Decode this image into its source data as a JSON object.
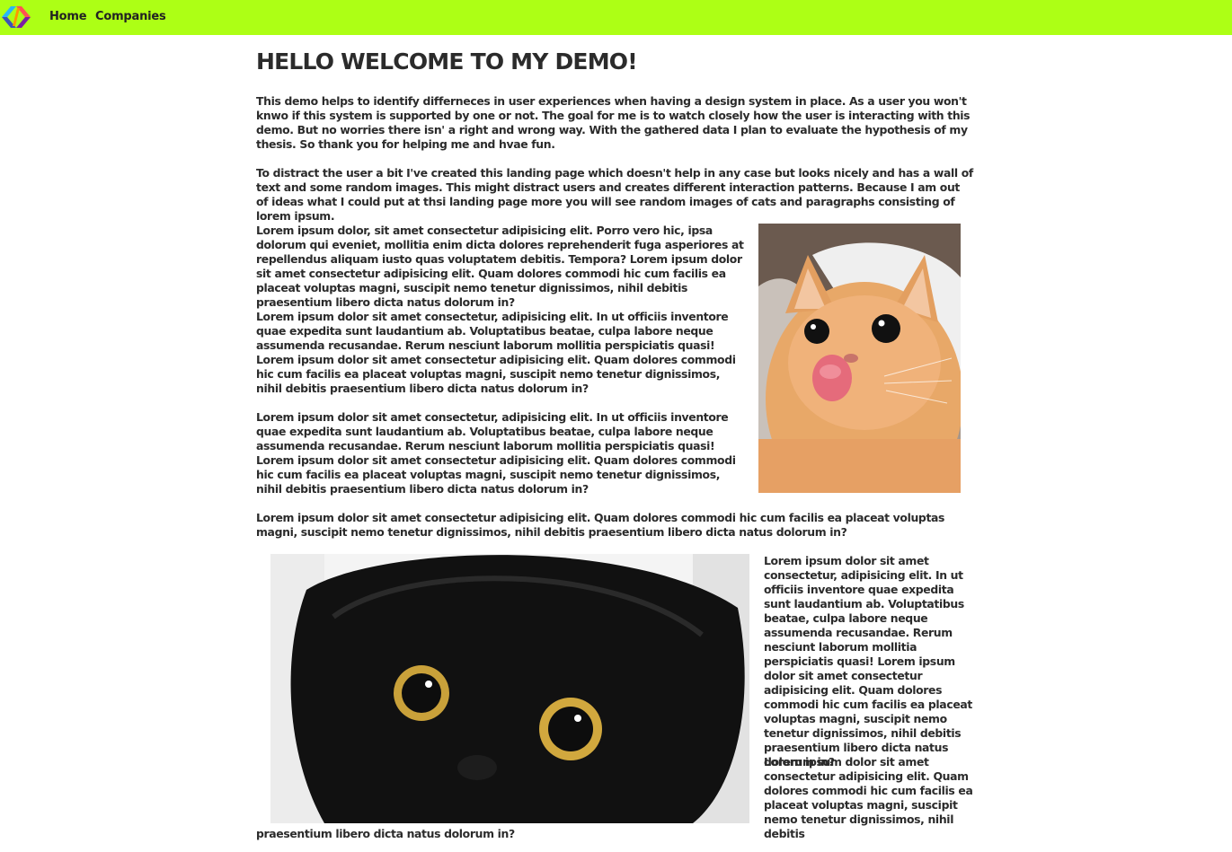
{
  "nav": {
    "logo_icon": "multicolor-chevrons-logo-icon",
    "items": [
      {
        "label": "Home"
      },
      {
        "label": "Companies"
      }
    ]
  },
  "colors": {
    "topbar": "#adff15",
    "text": "#2b2b2b"
  },
  "main": {
    "title": "HELLO WELCOME TO MY DEMO!",
    "intro": [
      "This demo helps to identify differneces in user experiences when having a design system in place. As a user you won't knwo if this system is supported by one or not. The goal for me is to watch closely how the user is interacting with this demo. But no worries there isn' a right and wrong way. With the gathered data I plan to evaluate the hypothesis of my thesis. So thank you for helping me and hvae fun.",
      "To distract the user a bit I've created this landing page which doesn't help in any case but looks nicely and has a wall of text and some random images. This might distract users and creates different interaction patterns. Because I am out of ideas what I could put at thsi landing page more you will see random images of cats and paragraphs consisting of lorem ipsum."
    ],
    "section1": [
      "Lorem ipsum dolor, sit amet consectetur adipisicing elit. Porro vero hic, ipsa dolorum qui eveniet, mollitia enim dicta dolores reprehenderit fuga asperiores at repellendus aliquam iusto quas voluptatem debitis. Tempora? Lorem ipsum dolor sit amet consectetur adipisicing elit. Quam dolores commodi hic cum facilis ea placeat voluptas magni, suscipit nemo tenetur dignissimos, nihil debitis praesentium libero dicta natus dolorum in?",
      "Lorem ipsum dolor sit amet consectetur, adipisicing elit. In ut officiis inventore quae expedita sunt laudantium ab. Voluptatibus beatae, culpa labore neque assumenda recusandae. Rerum nesciunt laborum mollitia perspiciatis quasi! Lorem ipsum dolor sit amet consectetur adipisicing elit. Quam dolores commodi hic cum facilis ea placeat voluptas magni, suscipit nemo tenetur dignissimos, nihil debitis praesentium libero dicta natus dolorum in?",
      "Lorem ipsum dolor sit amet consectetur, adipisicing elit. In ut officiis inventore quae expedita sunt laudantium ab. Voluptatibus beatae, culpa labore neque assumenda recusandae. Rerum nesciunt laborum mollitia perspiciatis quasi! Lorem ipsum dolor sit amet consectetur adipisicing elit. Quam dolores commodi hic cum facilis ea placeat voluptas magni, suscipit nemo tenetur dignissimos, nihil debitis praesentium libero dicta natus dolorum in?",
      "Lorem ipsum dolor sit amet consectetur adipisicing elit. Quam dolores commodi hic cum facilis ea placeat voluptas magni, suscipit nemo tenetur dignissimos, nihil debitis praesentium libero dicta natus dolorum in?"
    ],
    "section2": [
      "Lorem ipsum dolor sit amet consectetur, adipisicing elit. In ut officiis inventore quae expedita sunt laudantium ab. Voluptatibus beatae, culpa labore neque assumenda recusandae. Rerum nesciunt laborum mollitia perspiciatis quasi! Lorem ipsum dolor sit amet consectetur adipisicing elit. Quam dolores commodi hic cum facilis ea placeat voluptas magni, suscipit nemo tenetur dignissimos, nihil debitis praesentium libero dicta natus dolorum in?",
      "Lorem ipsum dolor sit amet consectetur adipisicing elit. Quam dolores commodi hic cum facilis ea placeat voluptas magni, suscipit nemo tenetur dignissimos, nihil debitis",
      "praesentium libero dicta natus dolorum in?"
    ],
    "images": [
      {
        "icon": "orange-cat-licking-image"
      },
      {
        "icon": "black-cat-closeup-image"
      }
    ]
  }
}
